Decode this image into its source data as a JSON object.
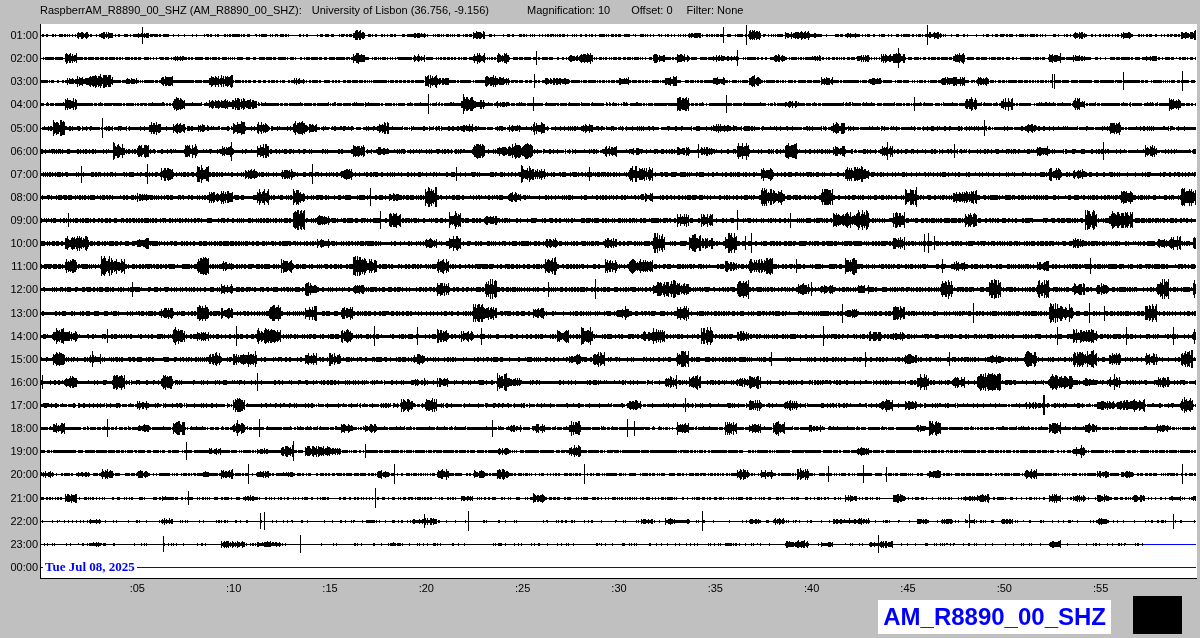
{
  "header": {
    "station": "RaspberrAM_R8890_00_SHZ (AM_R8890_00_SHZ):",
    "location": "University of Lisbon (36.756, -9.156)",
    "magnification": "Magnification: 10",
    "offset": "Offset: 0",
    "filter": "Filter: None"
  },
  "rows": [
    {
      "time": "01:00",
      "kind": "trace"
    },
    {
      "time": "02:00",
      "kind": "trace"
    },
    {
      "time": "03:00",
      "kind": "trace"
    },
    {
      "time": "04:00",
      "kind": "trace"
    },
    {
      "time": "05:00",
      "kind": "trace"
    },
    {
      "time": "06:00",
      "kind": "trace"
    },
    {
      "time": "07:00",
      "kind": "trace"
    },
    {
      "time": "08:00",
      "kind": "trace"
    },
    {
      "time": "09:00",
      "kind": "trace"
    },
    {
      "time": "10:00",
      "kind": "trace"
    },
    {
      "time": "11:00",
      "kind": "trace"
    },
    {
      "time": "12:00",
      "kind": "trace"
    },
    {
      "time": "13:00",
      "kind": "trace"
    },
    {
      "time": "14:00",
      "kind": "trace"
    },
    {
      "time": "15:00",
      "kind": "trace"
    },
    {
      "time": "16:00",
      "kind": "trace"
    },
    {
      "time": "17:00",
      "kind": "trace"
    },
    {
      "time": "18:00",
      "kind": "trace"
    },
    {
      "time": "19:00",
      "kind": "trace"
    },
    {
      "time": "20:00",
      "kind": "trace"
    },
    {
      "time": "21:00",
      "kind": "trace"
    },
    {
      "time": "22:00",
      "kind": "trace"
    },
    {
      "time": "23:00",
      "kind": "partial"
    },
    {
      "time": "00:00",
      "kind": "empty"
    }
  ],
  "date": "Tue Jul 08, 2025",
  "x_ticks": [
    ":05",
    ":10",
    ":15",
    ":20",
    ":25",
    ":30",
    ":35",
    ":40",
    ":45",
    ":50",
    ":55"
  ],
  "station_label": "AM_R8890_00_SHZ"
}
